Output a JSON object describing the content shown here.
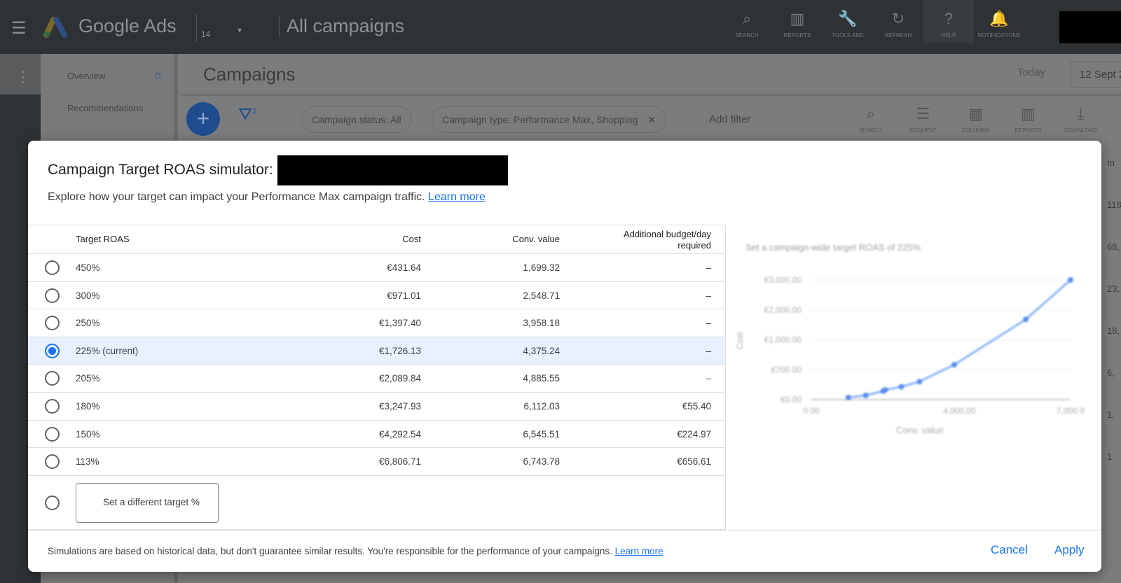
{
  "topbar": {
    "brand": "Google Ads",
    "account": "14",
    "section": "All campaigns",
    "icons": [
      {
        "icon": "search-icon",
        "label": "SEARCH"
      },
      {
        "icon": "reports-icon",
        "label": "REPORTS"
      },
      {
        "icon": "tools-icon",
        "label": "TOOLS AND"
      },
      {
        "icon": "refresh-icon",
        "label": "REFRESH"
      },
      {
        "icon": "help-icon",
        "label": "HELP"
      },
      {
        "icon": "bell-icon",
        "label": "NOTIFICATIONS"
      }
    ]
  },
  "sidenav": {
    "items": [
      "Overview",
      "Recommendations"
    ]
  },
  "page": {
    "title": "Campaigns",
    "today": "Today",
    "date": "12 Sept 2",
    "filter_count": "2",
    "chips": [
      "Campaign status: All",
      "Campaign type: Performance Max, Shopping"
    ],
    "add_filter": "Add filter",
    "tools": [
      {
        "icon": "search-icon",
        "label": "SEARCH"
      },
      {
        "icon": "segment-icon",
        "label": "SEGMENT"
      },
      {
        "icon": "columns-icon",
        "label": "COLUMNS"
      },
      {
        "icon": "reports-icon",
        "label": "REPORTS"
      },
      {
        "icon": "download-icon",
        "label": "DOWNLOAD"
      }
    ],
    "right_values": [
      "In",
      "118,",
      "68,",
      "23,",
      "18,",
      "6,",
      "1,",
      "1"
    ]
  },
  "modal": {
    "title": "Campaign Target ROAS simulator:",
    "subtitle": "Explore how your target can impact your Performance Max campaign traffic.",
    "learn_more": "Learn more",
    "columns": {
      "target": "Target ROAS",
      "cost": "Cost",
      "conv": "Conv. value",
      "additional": "Additional budget/day required"
    },
    "rows": [
      {
        "target": "450%",
        "cost": "€431.64",
        "conv": "1,699.32",
        "additional": "–",
        "selected": false
      },
      {
        "target": "300%",
        "cost": "€971.01",
        "conv": "2,548.71",
        "additional": "–",
        "selected": false
      },
      {
        "target": "250%",
        "cost": "€1,397.40",
        "conv": "3,958.18",
        "additional": "–",
        "selected": false
      },
      {
        "target": "225% (current)",
        "cost": "€1,726.13",
        "conv": "4,375.24",
        "additional": "–",
        "selected": true
      },
      {
        "target": "205%",
        "cost": "€2,089.84",
        "conv": "4,885.55",
        "additional": "–",
        "selected": false
      },
      {
        "target": "180%",
        "cost": "€3,247.93",
        "conv": "6,112.03",
        "additional": "€55.40",
        "selected": false
      },
      {
        "target": "150%",
        "cost": "€4,292.54",
        "conv": "6,545.51",
        "additional": "€224.97",
        "selected": false
      },
      {
        "target": "113%",
        "cost": "€6,806.71",
        "conv": "6,743.78",
        "additional": "€656.61",
        "selected": false
      }
    ],
    "custom_placeholder": "Set a different target %",
    "footer_note": "Simulations are based on historical data, but don't guarantee similar results. You're responsible for the performance of your campaigns.",
    "footer_learn_more": "Learn more",
    "cancel": "Cancel",
    "apply": "Apply"
  },
  "chart_data": {
    "type": "line",
    "title": "Set a campaign-wide target ROAS of 225%",
    "xlabel": "Conv. value",
    "ylabel": "Cost",
    "x_ticks": [
      "0.00",
      "4,000.00",
      "7,000.0"
    ],
    "y_ticks": [
      "€0.00",
      "€700.00",
      "€1,000.00",
      "€2,000.00",
      "€3,000.00"
    ],
    "color": "#8ab4f8",
    "points": [
      [
        1000,
        50
      ],
      [
        1470,
        100
      ],
      [
        1940,
        200
      ],
      [
        2000,
        230
      ],
      [
        2430,
        300
      ],
      [
        2920,
        420
      ],
      [
        3860,
        750
      ],
      [
        5790,
        1680
      ],
      [
        7000,
        3000
      ]
    ]
  }
}
